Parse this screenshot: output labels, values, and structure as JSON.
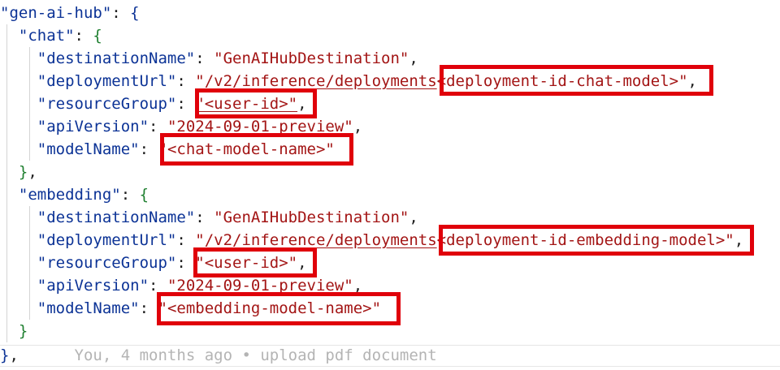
{
  "code": {
    "root_key": "\"gen-ai-hub\"",
    "chat_key": "\"chat\"",
    "embedding_key": "\"embedding\"",
    "keys": {
      "destinationName": "\"destinationName\"",
      "deploymentUrl": "\"deploymentUrl\"",
      "resourceGroup": "\"resourceGroup\"",
      "apiVersion": "\"apiVersion\"",
      "modelName": "\"modelName\""
    },
    "chat": {
      "destinationName": "\"GenAIHubDestination\"",
      "deploymentUrl_prefix": "\"/v2/inference/deployments",
      "deploymentUrl_id": "<deployment-id-chat-model>\"",
      "resourceGroup": "\"<user-id>\"",
      "apiVersion": "\"2024-09-01-preview\"",
      "modelName": "\"<chat-model-name>\""
    },
    "embedding": {
      "destinationName": "\"GenAIHubDestination\"",
      "deploymentUrl_prefix": "\"/v2/inference/deployments",
      "deploymentUrl_id": "<deployment-id-embedding-model>\"",
      "resourceGroup": "\"<user-id>\"",
      "apiVersion": "\"2024-09-01-preview\"",
      "modelName": "\"<embedding-model-name>\""
    },
    "blame": "You, 4 months ago • upload pdf document"
  },
  "colors": {
    "key": "#0c3396",
    "string": "#a31515",
    "bracket": "#1e7f2f",
    "highlight": "#e0000a",
    "ghost": "#b4b4b4"
  }
}
